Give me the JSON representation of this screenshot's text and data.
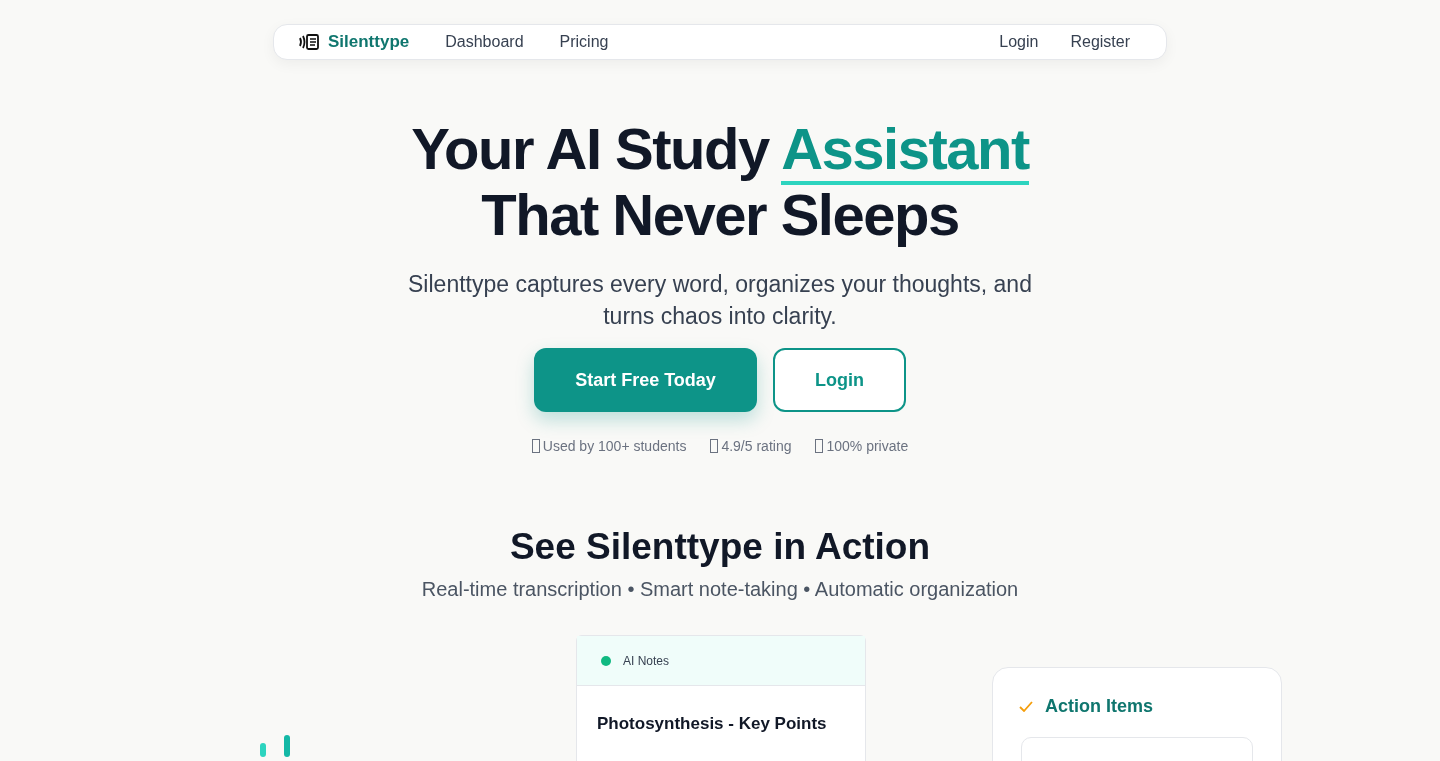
{
  "nav": {
    "brand": "Silenttype",
    "links": [
      {
        "label": "Dashboard"
      },
      {
        "label": "Pricing"
      }
    ],
    "auth": [
      {
        "label": "Login"
      },
      {
        "label": "Register"
      }
    ]
  },
  "hero": {
    "headline": [
      {
        "text": "Your AI Study ",
        "kind": "plain"
      },
      {
        "text": "Assistant",
        "kind": "highlight"
      },
      {
        "text": "That Never Sleeps",
        "kind": "break"
      }
    ],
    "subtitle": "Silenttype captures every word, organizes your thoughts, and turns chaos into clarity.",
    "buttons": [
      {
        "label": "Start Free Today",
        "kind": "primary"
      },
      {
        "label": "Login",
        "kind": "outline"
      }
    ],
    "stats": [
      {
        "text": "Used by 100+ students"
      },
      {
        "text": "4.9/5 rating"
      },
      {
        "text": "100% private"
      }
    ]
  },
  "demo": {
    "title": "See Silenttype in Action",
    "subtitle": "Real-time transcription • Smart note-taking • Automatic organization",
    "notes_card": {
      "label": "AI Notes",
      "color": "#10b981",
      "heading": "Photosynthesis - Key Points"
    },
    "actions_card": {
      "heading": "Action Items"
    }
  }
}
